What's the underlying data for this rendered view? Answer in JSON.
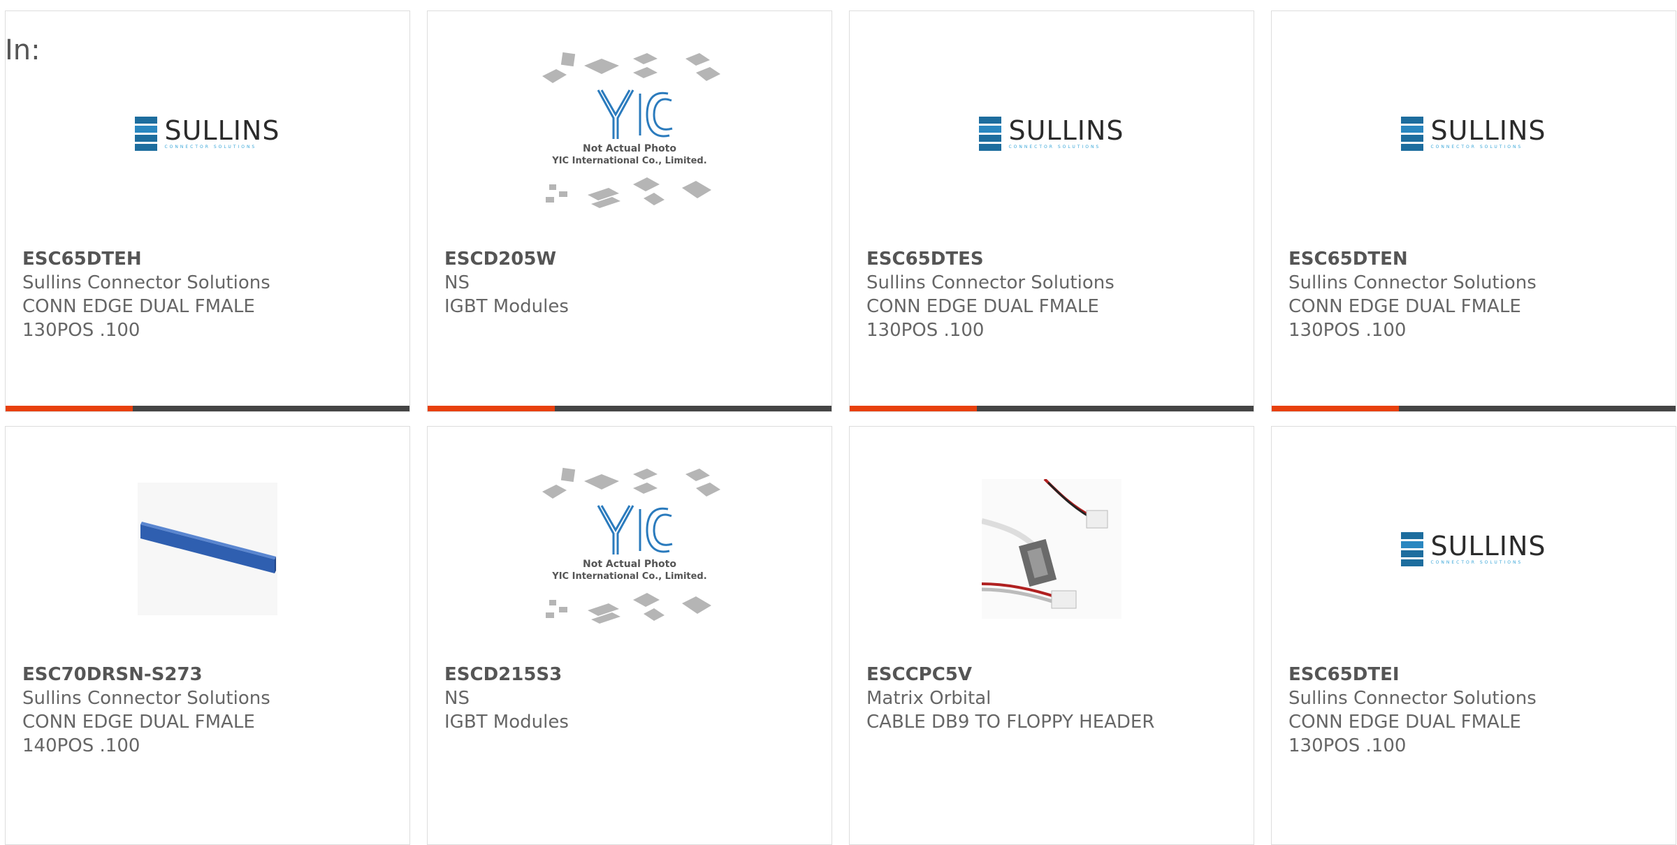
{
  "page": {
    "in_label": "In:"
  },
  "brand": {
    "accent_color": "#e8400c",
    "bar_color": "#444444"
  },
  "products": [
    {
      "part_number": "ESC65DTEH",
      "manufacturer": "Sullins Connector Solutions",
      "description_line1": "CONN EDGE DUAL FMALE",
      "description_line2": "130POS .100",
      "image": "sullins-logo",
      "logo_text": "SULLINS",
      "logo_subtext": "CONNECTOR SOLUTIONS"
    },
    {
      "part_number": "ESCD205W",
      "manufacturer": "NS",
      "description_line1": "IGBT Modules",
      "description_line2": "",
      "image": "yic-placeholder",
      "placeholder_line1": "Not Actual Photo",
      "placeholder_line2": "YIC International Co., Limited."
    },
    {
      "part_number": "ESC65DTES",
      "manufacturer": "Sullins Connector Solutions",
      "description_line1": "CONN EDGE DUAL FMALE",
      "description_line2": "130POS .100",
      "image": "sullins-logo",
      "logo_text": "SULLINS",
      "logo_subtext": "CONNECTOR SOLUTIONS"
    },
    {
      "part_number": "ESC65DTEN",
      "manufacturer": "Sullins Connector Solutions",
      "description_line1": "CONN EDGE DUAL FMALE",
      "description_line2": "130POS .100",
      "image": "sullins-logo",
      "logo_text": "SULLINS",
      "logo_subtext": "CONNECTOR SOLUTIONS"
    },
    {
      "part_number": "ESC70DRSN-S273",
      "manufacturer": "Sullins Connector Solutions",
      "description_line1": "CONN EDGE DUAL FMALE",
      "description_line2": "140POS .100",
      "image": "blue-edge-connector-photo"
    },
    {
      "part_number": "ESCD215S3",
      "manufacturer": "NS",
      "description_line1": "IGBT Modules",
      "description_line2": "",
      "image": "yic-placeholder",
      "placeholder_line1": "Not Actual Photo",
      "placeholder_line2": "YIC International Co., Limited."
    },
    {
      "part_number": "ESCCPC5V",
      "manufacturer": "Matrix Orbital",
      "description_line1": "CABLE DB9 TO FLOPPY HEADER",
      "description_line2": "",
      "image": "cable-photo"
    },
    {
      "part_number": "ESC65DTEI",
      "manufacturer": "Sullins Connector Solutions",
      "description_line1": "CONN EDGE DUAL FMALE",
      "description_line2": "130POS .100",
      "image": "sullins-logo",
      "logo_text": "SULLINS",
      "logo_subtext": "CONNECTOR SOLUTIONS"
    }
  ]
}
